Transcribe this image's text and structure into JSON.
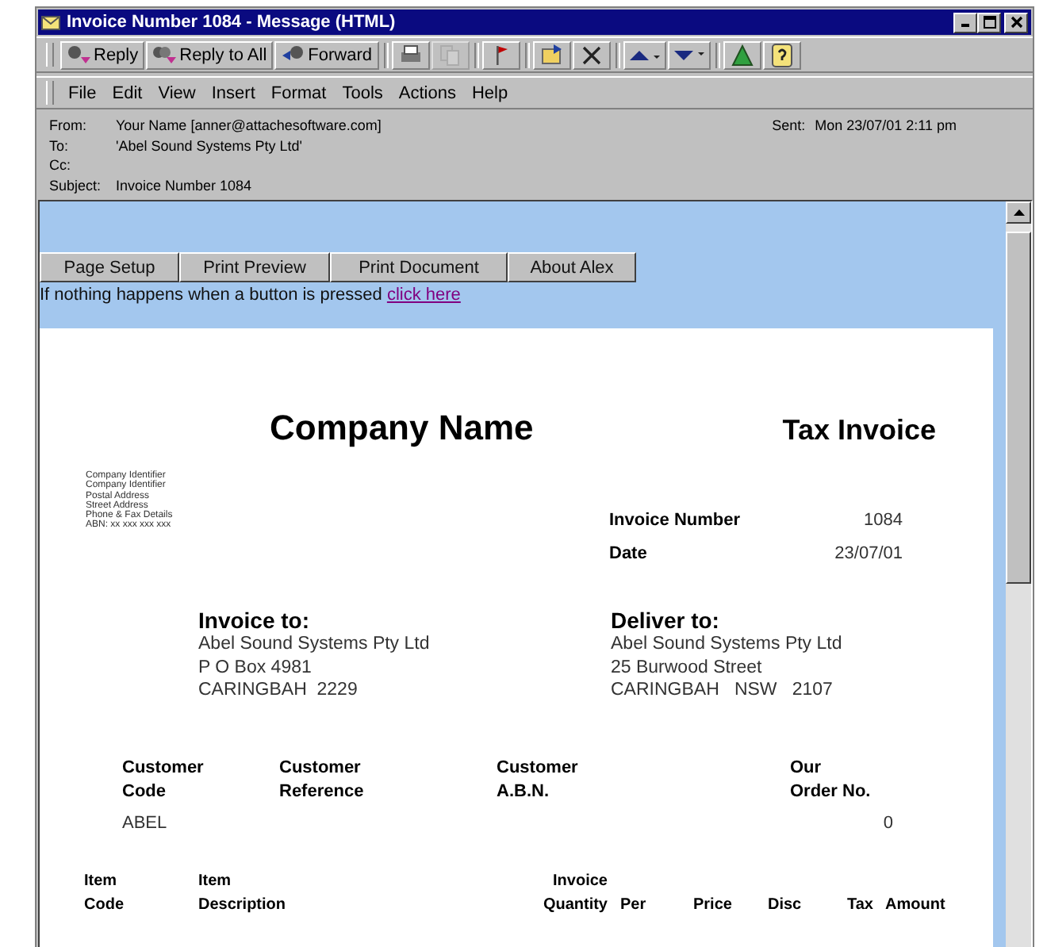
{
  "window": {
    "title": "Invoice Number 1084 - Message (HTML)"
  },
  "toolbar": [
    {
      "kind": "reply",
      "label": "Reply"
    },
    {
      "kind": "reply-all",
      "label": "Reply to All"
    },
    {
      "kind": "forward",
      "label": "Forward"
    },
    {
      "kind": "print"
    },
    {
      "kind": "copy",
      "disabled": true
    },
    {
      "kind": "flag"
    },
    {
      "kind": "move"
    },
    {
      "kind": "delete"
    },
    {
      "kind": "up"
    },
    {
      "kind": "down"
    },
    {
      "kind": "address"
    },
    {
      "kind": "help"
    }
  ],
  "menu": [
    "File",
    "Edit",
    "View",
    "Insert",
    "Format",
    "Tools",
    "Actions",
    "Help"
  ],
  "header": {
    "from_label": "From:",
    "from": "Your Name [anner@attachesoftware.com]",
    "sent_label": "Sent:",
    "sent": "Mon 23/07/01 2:11 pm",
    "to_label": "To:",
    "to": "'Abel Sound Systems Pty Ltd'",
    "cc_label": "Cc:",
    "subject_label": "Subject:",
    "subject": "Invoice Number 1084"
  },
  "page_buttons": [
    "Page Setup",
    "Print Preview",
    "Print Document",
    "About Alex"
  ],
  "notice": {
    "text": "If nothing happens when a button is pressed",
    "link": "click here"
  },
  "invoice": {
    "company_name": "Company Name",
    "doc_title": "Tax Invoice",
    "company_details": [
      "Company Identifier",
      "Company Identifier",
      "Postal Address",
      "Street Address",
      "Phone & Fax Details",
      "ABN: xx xxx xxx xxx"
    ],
    "facts": [
      {
        "label": "Invoice Number",
        "value": "1084"
      },
      {
        "label": "Date",
        "value": "23/07/01"
      }
    ],
    "invoice_to": {
      "heading": "Invoice to:",
      "lines": [
        "Abel Sound Systems Pty Ltd",
        "P O Box 4981",
        "CARINGBAH  2229"
      ]
    },
    "deliver_to": {
      "heading": "Deliver to:",
      "lines": [
        "Abel Sound Systems Pty Ltd",
        "25 Burwood Street",
        "CARINGBAH   NSW   2107"
      ]
    },
    "customer_columns": [
      {
        "label": "Customer\nCode",
        "value": "ABEL"
      },
      {
        "label": "Customer\nReference"
      },
      {
        "label": "Customer\nA.B.N."
      },
      {
        "label": "Our\nOrder No.",
        "value": "0"
      }
    ],
    "item_columns": [
      "Item\nCode",
      "Item\nDescription",
      "Invoice\nQuantity",
      "Per",
      "Price",
      "Disc",
      "Tax",
      "Amount"
    ]
  }
}
